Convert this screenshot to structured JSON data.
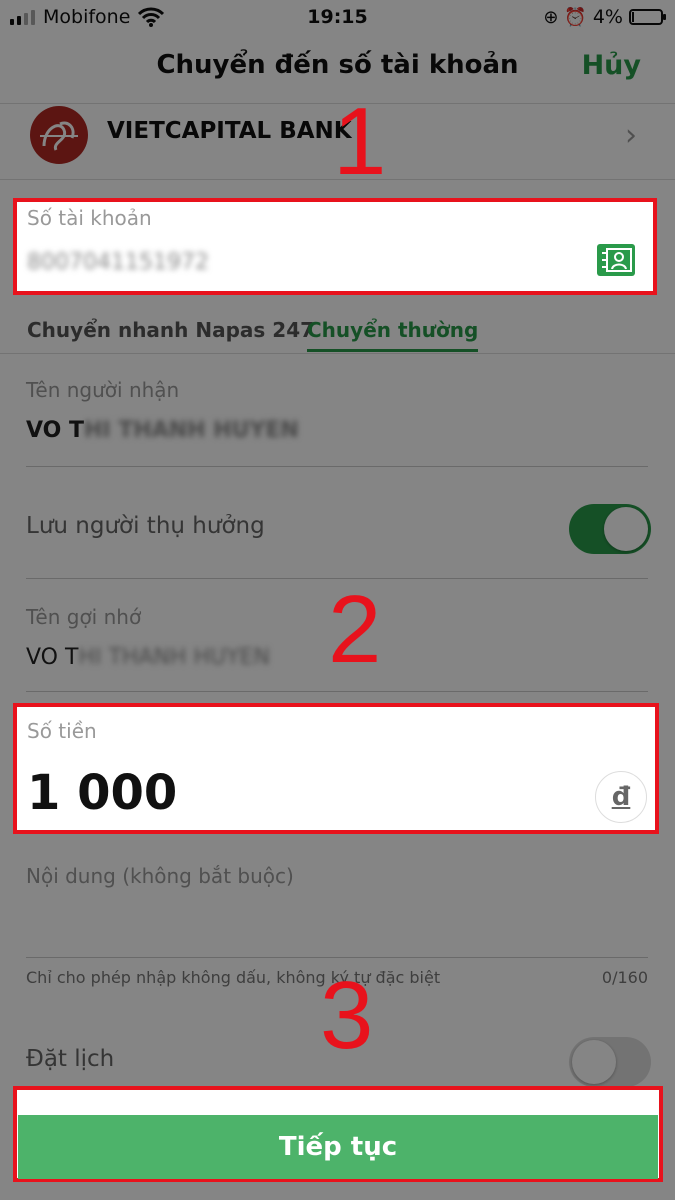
{
  "status_bar": {
    "carrier": "Mobifone",
    "time": "19:15",
    "battery": "4%"
  },
  "header": {
    "title": "Chuyển đến số tài khoản",
    "cancel_label": "Hủy"
  },
  "bank": {
    "name": "VIETCAPITAL BANK"
  },
  "account": {
    "label": "Số tài khoản",
    "value": "8007041151972"
  },
  "tabs": [
    {
      "label": "Chuyển nhanh Napas 247",
      "active": false
    },
    {
      "label": "Chuyển thường",
      "active": true
    }
  ],
  "recipient": {
    "label": "Tên người nhận",
    "value_visible": "VO T",
    "value_blurred": "HI THANH HUYEN"
  },
  "save_beneficiary": {
    "label": "Lưu người thụ hưởng",
    "on": true
  },
  "nickname": {
    "label": "Tên gợi nhớ",
    "value_visible": "VO T",
    "value_blurred": "HI THANH HUYEN"
  },
  "amount": {
    "label": "Số tiền",
    "value": "1 000",
    "currency_symbol": "đ"
  },
  "content": {
    "label": "Nội dung (không bắt buộc)",
    "hint": "Chỉ cho phép nhập không dấu, không ký tự đặc biệt",
    "counter": "0/160"
  },
  "schedule": {
    "label": "Đặt lịch",
    "on": false
  },
  "continue_button": {
    "label": "Tiếp tục"
  },
  "annotations": [
    "1",
    "2",
    "3"
  ],
  "colors": {
    "accent": "#2a9a4a",
    "button": "#4db36a",
    "highlight": "#e8121c",
    "bank_logo": "#b02a24"
  }
}
